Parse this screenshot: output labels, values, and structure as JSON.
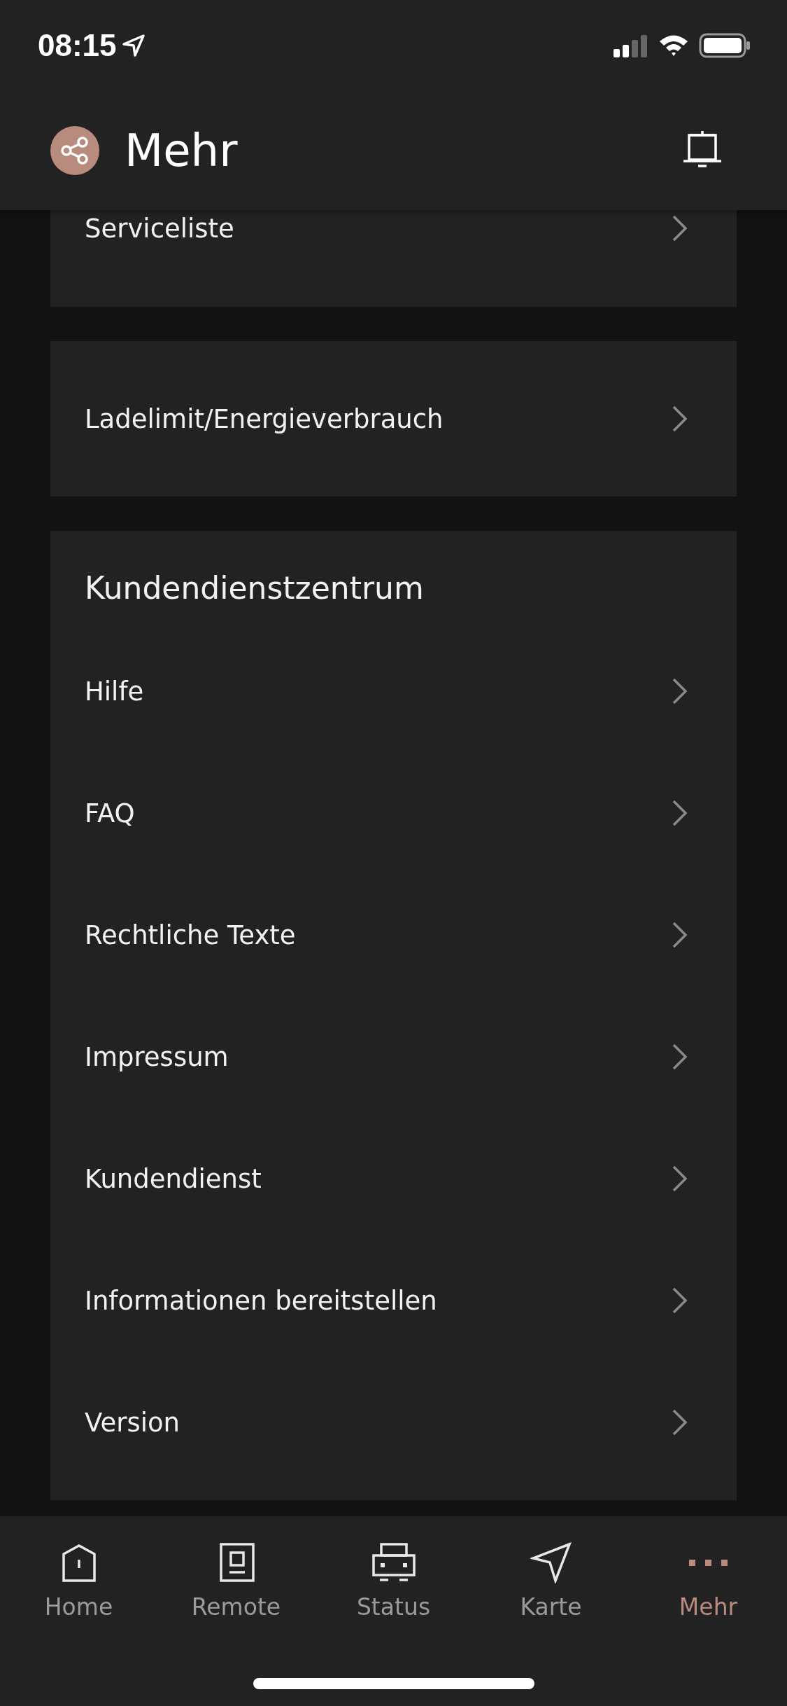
{
  "status_bar": {
    "time": "08:15"
  },
  "header": {
    "title": "Mehr"
  },
  "cards": [
    {
      "items": [
        {
          "label": "Serviceliste"
        }
      ]
    },
    {
      "items": [
        {
          "label": "Ladelimit/Energieverbrauch"
        }
      ]
    },
    {
      "title": "Kundendienstzentrum",
      "items": [
        {
          "label": "Hilfe"
        },
        {
          "label": "FAQ"
        },
        {
          "label": "Rechtliche Texte"
        },
        {
          "label": "Impressum"
        },
        {
          "label": "Kundendienst"
        },
        {
          "label": "Informationen bereitstellen"
        },
        {
          "label": "Version"
        }
      ]
    }
  ],
  "tabs": [
    {
      "label": "Home",
      "selected": false
    },
    {
      "label": "Remote",
      "selected": false
    },
    {
      "label": "Status",
      "selected": false
    },
    {
      "label": "Karte",
      "selected": false
    },
    {
      "label": "Mehr",
      "selected": true
    }
  ]
}
